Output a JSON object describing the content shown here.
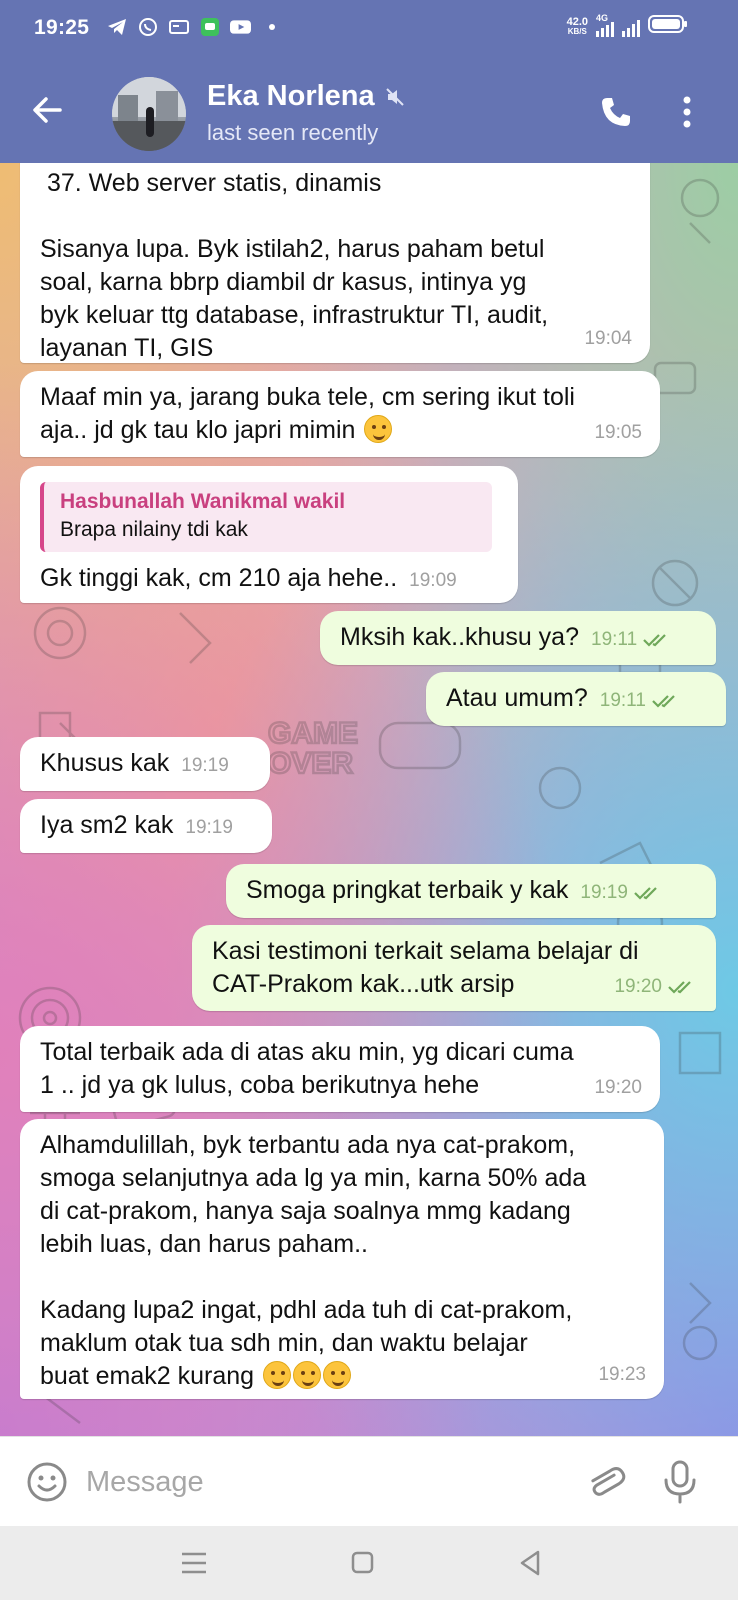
{
  "status_bar": {
    "time": "19:25",
    "net_speed": "42.0",
    "net_unit": "KB/S",
    "network": "4G"
  },
  "header": {
    "contact_name": "Eka Norlena",
    "contact_status": "last seen recently"
  },
  "messages": [
    {
      "dir": "in",
      "text": " 37. Web server statis, dinamis\n\nSisanya lupa. Byk istilah2, harus paham betul\nsoal, karna bbrp diambil dr kasus, intinya yg\nbyk keluar ttg database, infrastruktur TI, audit,\nlayanan TI, GIS",
      "time": "19:04"
    },
    {
      "dir": "in",
      "text": "Maaf min ya, jarang buka tele, cm sering ikut toli\naja.. jd gk tau klo japri mimin",
      "time": "19:05"
    },
    {
      "dir": "in",
      "reply_name": "Hasbunallah Wanikmal wakil",
      "reply_text": "Brapa nilainy tdi kak",
      "text": "Gk tinggi kak, cm 210 aja hehe..",
      "time": "19:09"
    },
    {
      "dir": "out",
      "text": "Mksih kak..khusu ya?",
      "time": "19:11"
    },
    {
      "dir": "out",
      "text": "Atau umum?",
      "time": "19:11"
    },
    {
      "dir": "in",
      "text": "Khusus kak",
      "time": "19:19"
    },
    {
      "dir": "in",
      "text": "Iya sm2 kak",
      "time": "19:19"
    },
    {
      "dir": "out",
      "text": "Smoga pringkat terbaik y kak",
      "time": "19:19"
    },
    {
      "dir": "out",
      "text": "Kasi testimoni terkait selama belajar di\nCAT-Prakom kak...utk arsip",
      "time": "19:20"
    },
    {
      "dir": "in",
      "text": "Total terbaik ada di atas aku min, yg dicari cuma\n1 .. jd ya gk lulus, coba berikutnya hehe",
      "time": "19:20"
    },
    {
      "dir": "in",
      "text": "Alhamdulillah, byk terbantu ada nya cat-prakom,\nsmoga selanjutnya ada lg ya min, karna 50% ada\ndi cat-prakom, hanya saja soalnya mmg kadang\nlebih luas, dan harus paham..\n\nKadang lupa2 ingat, pdhl ada tuh di cat-prakom,\nmaklum otak tua sdh min, dan waktu belajar\nbuat emak2 kurang",
      "time": "19:23"
    }
  ],
  "input": {
    "placeholder": "Message"
  },
  "icons": {
    "back": "arrow-left-icon",
    "mute": "muted-speaker-icon",
    "call": "phone-icon",
    "more": "more-vertical-icon",
    "emoji": "emoji-icon",
    "attach": "paperclip-icon",
    "mic": "microphone-icon"
  },
  "colors": {
    "header": "#6574b3",
    "incoming_bubble": "#ffffff",
    "outgoing_bubble": "#effdde",
    "reply_name": "#c9407f",
    "check": "#6fa85a"
  }
}
